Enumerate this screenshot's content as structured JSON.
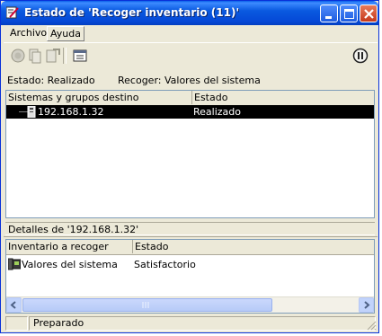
{
  "window": {
    "title": "Estado de 'Recoger inventario (11)'",
    "colors": {
      "titlebar": "#0a5ae0",
      "face": "#ece9d8",
      "selection": "#000000"
    }
  },
  "menu": {
    "items": [
      "Archivo",
      "Ayuda"
    ]
  },
  "toolbar": {
    "icons": [
      "record-icon",
      "copy-icon",
      "document-arrow-icon",
      "properties-icon",
      "pause-icon"
    ]
  },
  "status": {
    "state_text": "Estado: Realizado",
    "collect_text": "Recoger: Valores del sistema"
  },
  "targets_table": {
    "columns": [
      "Sistemas y grupos destino",
      "Estado"
    ],
    "rows": [
      {
        "name": "192.168.1.32",
        "state": "Realizado",
        "selected": true
      }
    ]
  },
  "details": {
    "label": "Detalles de '192.168.1.32'",
    "columns": [
      "Inventario a recoger",
      "Estado"
    ],
    "rows": [
      {
        "item": "Valores del sistema",
        "state": "Satisfactorio"
      }
    ]
  },
  "statusbar": {
    "text": "Preparado"
  }
}
